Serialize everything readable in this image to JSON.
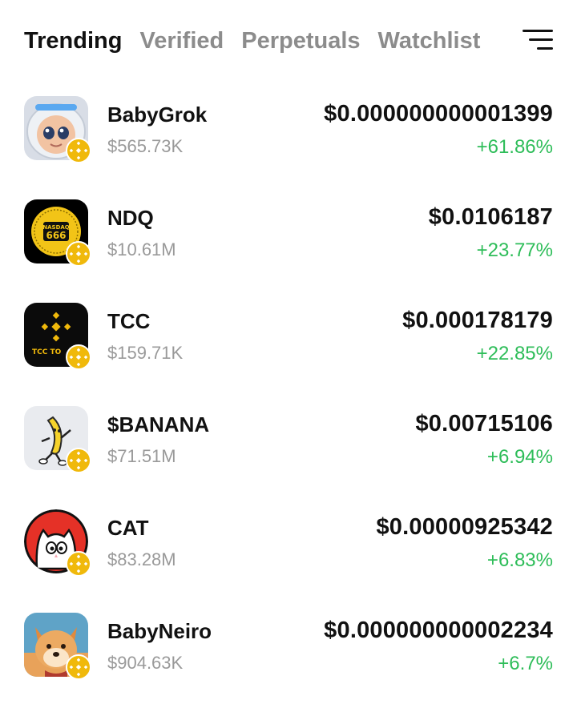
{
  "tabs": [
    {
      "label": "Trending",
      "active": true
    },
    {
      "label": "Verified",
      "active": false
    },
    {
      "label": "Perpetuals",
      "active": false
    },
    {
      "label": "Watchlist",
      "active": false
    }
  ],
  "filter_icon": "filter-icon",
  "colors": {
    "positive": "#2EBD59",
    "muted": "#9a9a9a",
    "chain_badge": "#F0B90B"
  },
  "tokens": [
    {
      "name": "BabyGrok",
      "market_cap": "$565.73K",
      "price": "$0.000000000001399",
      "change": "+61.86%",
      "icon": "babygrok-logo"
    },
    {
      "name": "NDQ",
      "market_cap": "$10.61M",
      "price": "$0.0106187",
      "change": "+23.77%",
      "icon": "ndq-logo",
      "logo_text": [
        "NASDAQ",
        "666"
      ]
    },
    {
      "name": "TCC",
      "market_cap": "$159.71K",
      "price": "$0.000178179",
      "change": "+22.85%",
      "icon": "tcc-logo",
      "logo_text": [
        "TCC TO"
      ]
    },
    {
      "name": "$BANANA",
      "market_cap": "$71.51M",
      "price": "$0.00715106",
      "change": "+6.94%",
      "icon": "banana-logo"
    },
    {
      "name": "CAT",
      "market_cap": "$83.28M",
      "price": "$0.00000925342",
      "change": "+6.83%",
      "icon": "cat-logo"
    },
    {
      "name": "BabyNeiro",
      "market_cap": "$904.63K",
      "price": "$0.000000000002234",
      "change": "+6.7%",
      "icon": "babyneiro-logo"
    }
  ]
}
